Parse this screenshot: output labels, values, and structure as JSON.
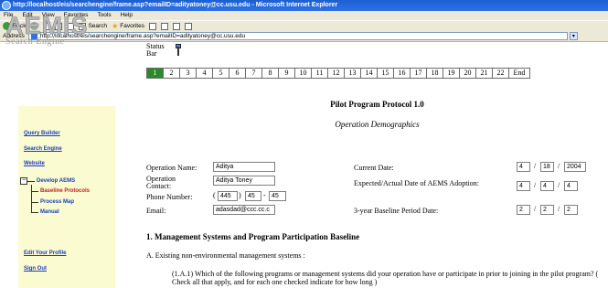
{
  "browser": {
    "title": "http://localhost/eis/searchengine/frame.asp?emailID=adityatoney@cc.usu.edu - Microsoft Internet Explorer",
    "menu": [
      "File",
      "Edit",
      "View",
      "Favorites",
      "Tools",
      "Help"
    ],
    "toolbar": {
      "back": "Back",
      "search": "Search",
      "favorites": "Favorites"
    },
    "address_label": "Address",
    "address_url": "http://localhost/eis/searchengine/frame.asp?emailID=adityatoney@cc.usu.edu"
  },
  "logo": {
    "title": "AEMIS",
    "subtitle": "Search Engine"
  },
  "status_bar": {
    "label": "Status Bar",
    "steps": [
      "1",
      "2",
      "3",
      "4",
      "5",
      "6",
      "7",
      "8",
      "9",
      "10",
      "11",
      "12",
      "13",
      "14",
      "15",
      "16",
      "17",
      "18",
      "19",
      "20",
      "21",
      "22",
      "End"
    ],
    "active_step": "1"
  },
  "sidebar": {
    "links": [
      "Query Builder",
      "Search Engine",
      "Website"
    ],
    "tree": {
      "root": "Develop AEMS",
      "children": [
        "Baseline Protocols",
        "Process Map",
        "Manual"
      ]
    },
    "bottom_links": [
      "Edit Your Profile",
      "Sign Out"
    ]
  },
  "form": {
    "title": "Pilot Program Protocol 1.0",
    "subtitle": "Operation Demographics",
    "operation_name_label": "Operation Name:",
    "operation_name_value": "Aditya",
    "operation_contact_label": "Operation Contact:",
    "operation_contact_value": "Aditya Toney",
    "phone_label": "Phone Number:",
    "phone_area": "445",
    "phone_prefix": "45",
    "phone_line": "45",
    "email_label": "Email:",
    "email_value": "adasdad@ccc.cc.c",
    "current_date_label": "Current Date:",
    "current_date": [
      "4",
      "18",
      "2004"
    ],
    "adoption_label": "Expected/Actual Date of AEMS Adoption:",
    "adoption_date": [
      "4",
      "4",
      "4"
    ],
    "baseline_label": "3-year Baseline Period Date:",
    "baseline_date": [
      "2",
      "2",
      "2"
    ]
  },
  "section": {
    "header": "1. Management Systems and Program Participation Baseline",
    "subsection": "A. Existing non-environmental management systems :",
    "question": "(1.A.1) Which of the following programs or management systems did your operation have or participate in prior to joining in the pilot program? ( Check all that apply, and for each one checked indicate for how long )"
  }
}
